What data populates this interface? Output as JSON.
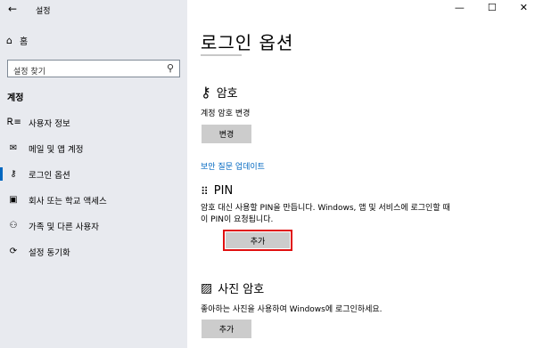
{
  "app": {
    "title": "설정",
    "back_icon": "back-arrow-icon"
  },
  "sidebar": {
    "home_label": "홈",
    "search_placeholder": "설정 찾기",
    "section_label": "계정",
    "items": [
      {
        "label": "사용자 정보",
        "icon": "user-info-icon",
        "active": false
      },
      {
        "label": "메일 및 앱 계정",
        "icon": "mail-icon",
        "active": false
      },
      {
        "label": "로그인 옵션",
        "icon": "key-icon",
        "active": true
      },
      {
        "label": "회사 또는 학교 액세스",
        "icon": "briefcase-icon",
        "active": false
      },
      {
        "label": "가족 및 다른 사용자",
        "icon": "people-icon",
        "active": false
      },
      {
        "label": "설정 동기화",
        "icon": "sync-icon",
        "active": false
      }
    ]
  },
  "window_controls": {
    "minimize": "—",
    "maximize": "☐",
    "close": "✕"
  },
  "main": {
    "title": "로그인 옵션",
    "password": {
      "heading": "암호",
      "desc": "계정 암호 변경",
      "button": "변경",
      "link": "보안 질문 업데이트"
    },
    "pin": {
      "heading": "PIN",
      "desc": "암호 대신 사용할 PIN을 만듭니다. Windows, 앱 및 서비스에 로그인할 때 이 PIN이 요청됩니다.",
      "button": "추가"
    },
    "picture_password": {
      "heading": "사진 암호",
      "desc": "좋아하는 사진을 사용하여 Windows에 로그인하세요.",
      "button": "추가"
    }
  },
  "colors": {
    "accent": "#0067c0",
    "highlight": "#e01010",
    "sidebar_bg": "#e8eaef",
    "button_bg": "#cccccc"
  }
}
